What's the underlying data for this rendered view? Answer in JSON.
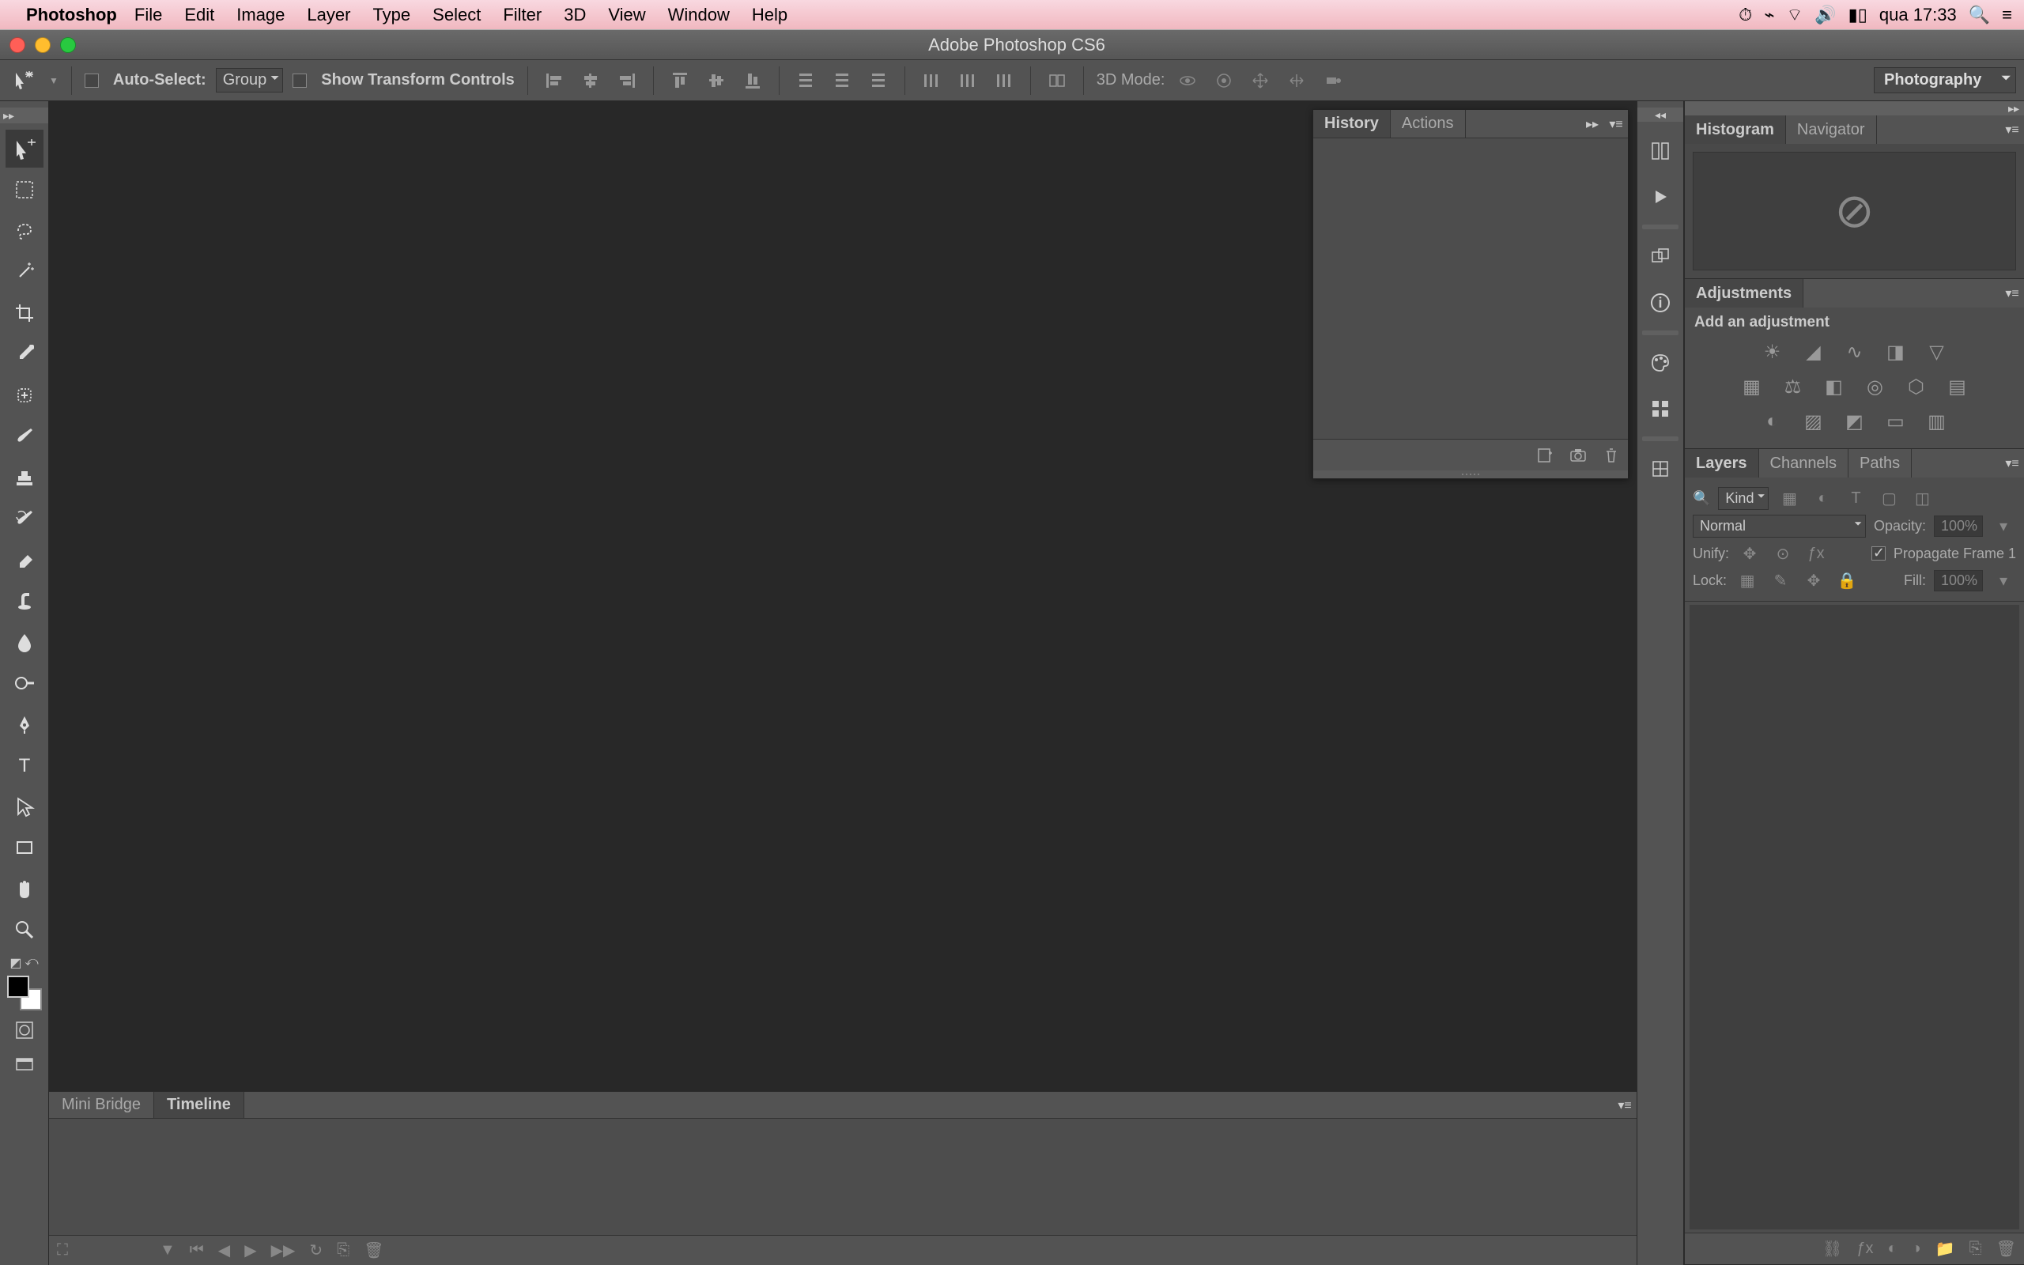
{
  "menubar": {
    "app": "Photoshop",
    "items": [
      "File",
      "Edit",
      "Image",
      "Layer",
      "Type",
      "Select",
      "Filter",
      "3D",
      "View",
      "Window",
      "Help"
    ],
    "clock": "qua 17:33"
  },
  "window": {
    "title": "Adobe Photoshop CS6"
  },
  "options": {
    "autoSelect": "Auto-Select:",
    "groupSelect": "Group",
    "showTransform": "Show Transform Controls",
    "mode3d": "3D Mode:",
    "workspace": "Photography"
  },
  "historyPanel": {
    "tabs": [
      "History",
      "Actions"
    ]
  },
  "rightPanels": {
    "histogramTabs": [
      "Histogram",
      "Navigator"
    ],
    "adjustmentsTab": "Adjustments",
    "addAdjustment": "Add an adjustment",
    "layersTabs": [
      "Layers",
      "Channels",
      "Paths"
    ],
    "kind": "Kind",
    "blendMode": "Normal",
    "opacityLabel": "Opacity:",
    "opacityValue": "100%",
    "unifyLabel": "Unify:",
    "propagateLabel": "Propagate Frame 1",
    "lockLabel": "Lock:",
    "fillLabel": "Fill:",
    "fillValue": "100%"
  },
  "bottomPanel": {
    "tabs": [
      "Mini Bridge",
      "Timeline"
    ]
  }
}
